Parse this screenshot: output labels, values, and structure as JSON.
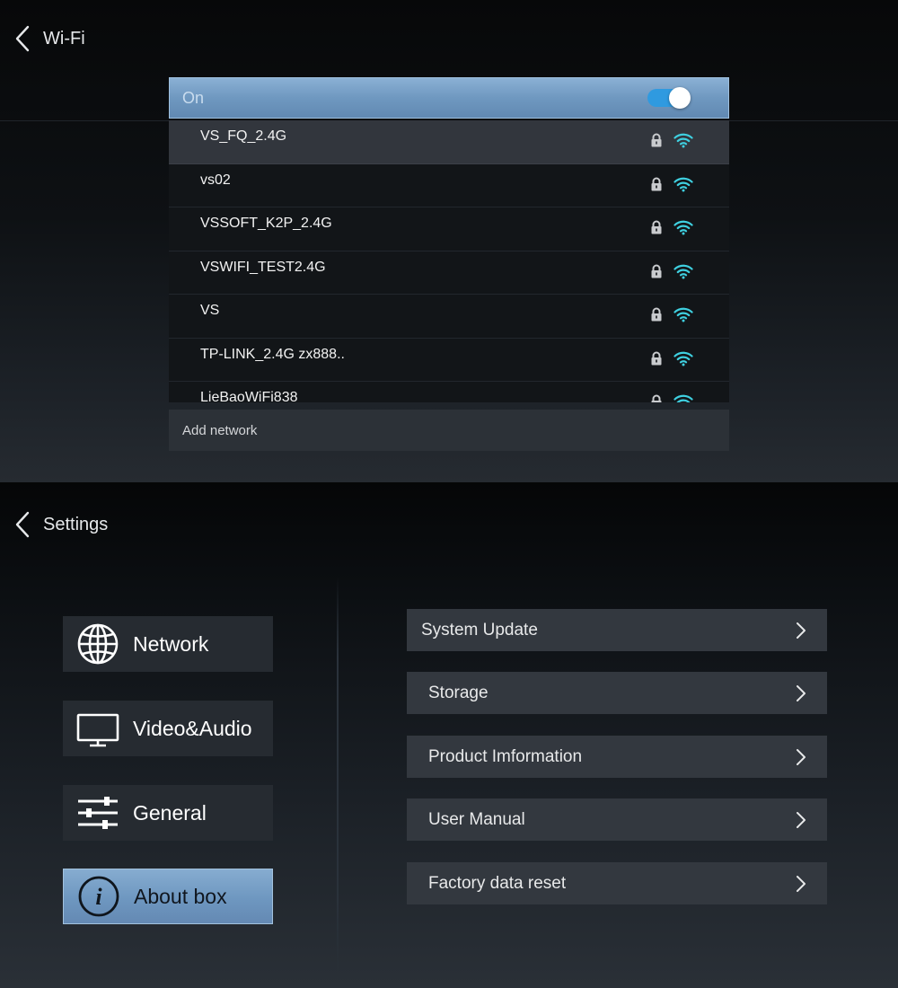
{
  "wifi": {
    "title": "Wi-Fi",
    "toggle_label": "On",
    "toggle_on": true,
    "networks": [
      {
        "ssid": "VS_FQ_2.4G",
        "secured": true,
        "signal": "full",
        "selected": true
      },
      {
        "ssid": "vs02",
        "secured": true,
        "signal": "full",
        "selected": false
      },
      {
        "ssid": "VSSOFT_K2P_2.4G",
        "secured": true,
        "signal": "full",
        "selected": false
      },
      {
        "ssid": "VSWIFI_TEST2.4G",
        "secured": true,
        "signal": "full",
        "selected": false
      },
      {
        "ssid": "VS",
        "secured": true,
        "signal": "full",
        "selected": false
      },
      {
        "ssid": "TP-LINK_2.4G zx888..",
        "secured": true,
        "signal": "full",
        "selected": false
      },
      {
        "ssid": "LieBaoWiFi838",
        "secured": true,
        "signal": "full",
        "selected": false
      }
    ],
    "add_network_label": "Add network",
    "colors": {
      "signal": "#3fd0e0",
      "toggle_track": "#2f9ae0",
      "highlight": "#7aa2c9"
    }
  },
  "settings": {
    "title": "Settings",
    "categories": [
      {
        "label": "Network",
        "icon": "globe-icon",
        "active": false
      },
      {
        "label": "Video&Audio",
        "icon": "monitor-icon",
        "active": false
      },
      {
        "label": "General",
        "icon": "sliders-icon",
        "active": false
      },
      {
        "label": "About box",
        "icon": "info-icon",
        "active": true
      }
    ],
    "menu": [
      {
        "label": "System Update",
        "icon": "chevron-right-icon"
      },
      {
        "label": "Storage",
        "icon": "chevron-right-icon"
      },
      {
        "label": "Product Imformation",
        "icon": "chevron-right-icon"
      },
      {
        "label": "User Manual",
        "icon": "chevron-right-icon"
      },
      {
        "label": "Factory data reset",
        "icon": "chevron-right-icon"
      }
    ]
  }
}
